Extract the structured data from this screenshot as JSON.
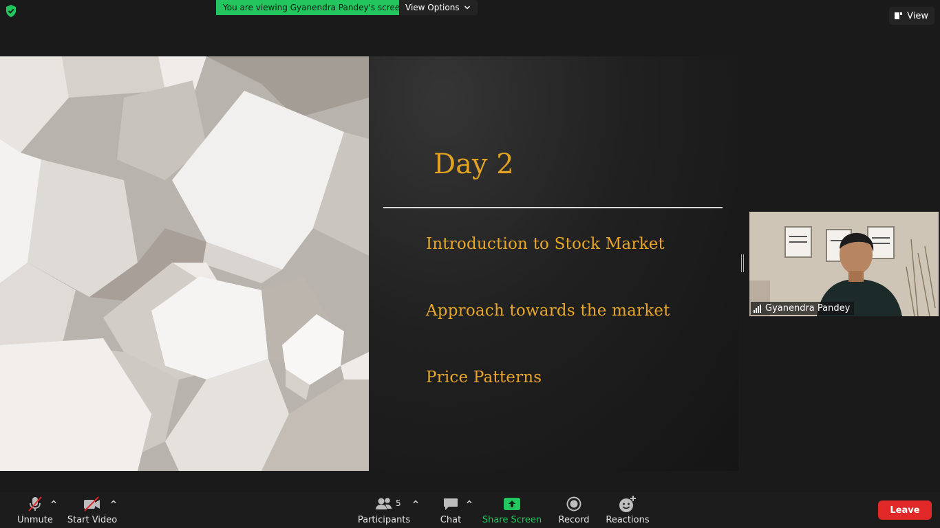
{
  "topbar": {
    "viewing_text": "You are viewing Gyanendra Pandey's screen",
    "view_options_label": "View Options",
    "view_label": "View"
  },
  "slide": {
    "title": "Day 2",
    "items": [
      "Introduction to Stock Market",
      "Approach towards the market",
      "Price Patterns"
    ]
  },
  "video": {
    "participant_name": "Gyanendra Pandey"
  },
  "toolbar": {
    "unmute_label": "Unmute",
    "start_video_label": "Start Video",
    "participants_label": "Participants",
    "participants_count": "5",
    "chat_label": "Chat",
    "share_screen_label": "Share Screen",
    "record_label": "Record",
    "reactions_label": "Reactions",
    "leave_label": "Leave"
  },
  "colors": {
    "accent_green": "#22c55e",
    "leave_red": "#e02828",
    "slide_text_gold": "#e3a321"
  },
  "icons": [
    "shield-icon",
    "chevron-down-icon",
    "view-layout-icon",
    "muted-mic-icon",
    "video-off-icon",
    "participants-icon",
    "chat-icon",
    "share-screen-icon",
    "record-icon",
    "reactions-icon",
    "signal-bars-icon"
  ]
}
